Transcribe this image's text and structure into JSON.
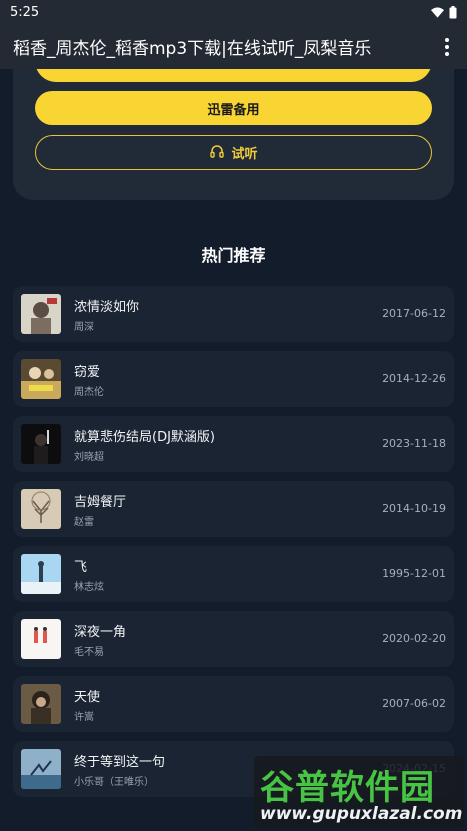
{
  "status_bar": {
    "time": "5:25"
  },
  "app_bar": {
    "title": "稻香_周杰伦_稻香mp3下载|在线试听_凤梨音乐"
  },
  "actions": {
    "partial_button": "",
    "backup_button": "迅雷备用",
    "listen_button": "试听"
  },
  "section": {
    "title": "热门推荐"
  },
  "songs": [
    {
      "title": "浓情淡如你",
      "artist": "周深",
      "date": "2017-06-12"
    },
    {
      "title": "窃爱",
      "artist": "周杰伦",
      "date": "2014-12-26"
    },
    {
      "title": "就算悲伤结局(DJ默涵版)",
      "artist": "刘晓超",
      "date": "2023-11-18"
    },
    {
      "title": "吉姆餐厅",
      "artist": "赵雷",
      "date": "2014-10-19"
    },
    {
      "title": "飞",
      "artist": "林志炫",
      "date": "1995-12-01"
    },
    {
      "title": "深夜一角",
      "artist": "毛不易",
      "date": "2020-02-20"
    },
    {
      "title": "天使",
      "artist": "许嵩",
      "date": "2007-06-02"
    },
    {
      "title": "终于等到这一句",
      "artist": "小乐哥（王唯乐）",
      "date": "2024-02-15"
    }
  ],
  "watermark": {
    "main": "谷普软件园",
    "url": "www.gupuxlazal.com"
  },
  "colors": {
    "accent": "#f9d533",
    "background": "#131c2a",
    "card": "#212a37",
    "watermark_green": "#48c445"
  }
}
